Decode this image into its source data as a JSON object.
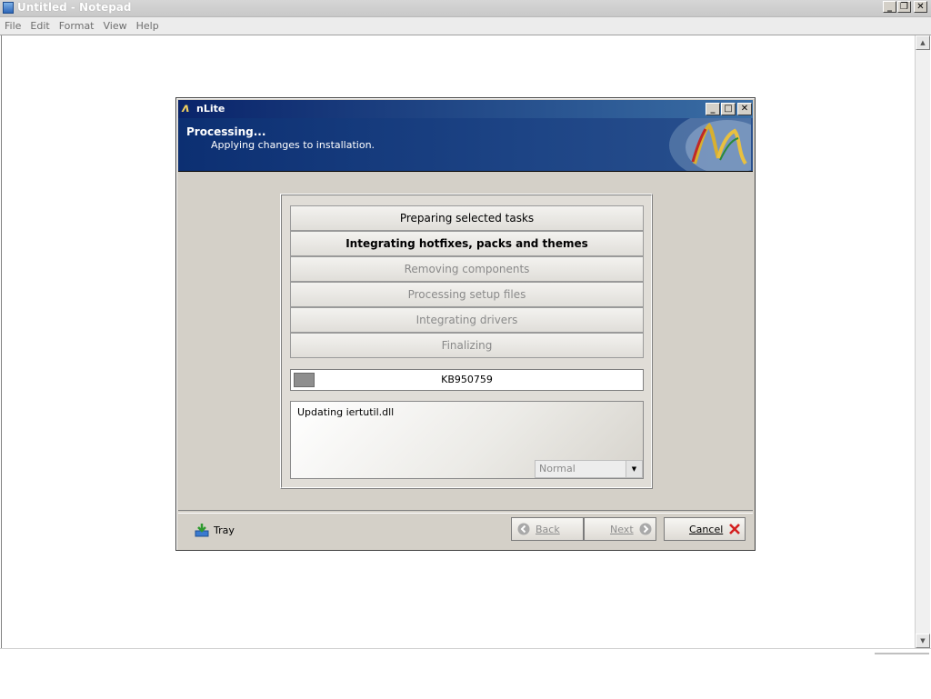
{
  "notepad": {
    "title": "Untitled - Notepad",
    "menu": [
      "File",
      "Edit",
      "Format",
      "View",
      "Help"
    ]
  },
  "dialog": {
    "title": "nLite",
    "header_title": "Processing...",
    "header_subtitle": "Applying changes to installation.",
    "steps": [
      {
        "label": "Preparing selected tasks",
        "state": "done"
      },
      {
        "label": "Integrating hotfixes, packs and themes",
        "state": "active"
      },
      {
        "label": "Removing components",
        "state": "pending"
      },
      {
        "label": "Processing setup files",
        "state": "pending"
      },
      {
        "label": "Integrating drivers",
        "state": "pending"
      },
      {
        "label": "Finalizing",
        "state": "pending"
      }
    ],
    "progress": {
      "label": "KB950759",
      "fraction": 0.06
    },
    "log_text": "Updating iertutil.dll",
    "priority_select": "Normal",
    "tray_label": "Tray",
    "back_label": "Back",
    "next_label": "Next",
    "cancel_label": "Cancel",
    "colors": {
      "header_bg": "#1d4485",
      "cancel_x": "#d42020"
    }
  }
}
